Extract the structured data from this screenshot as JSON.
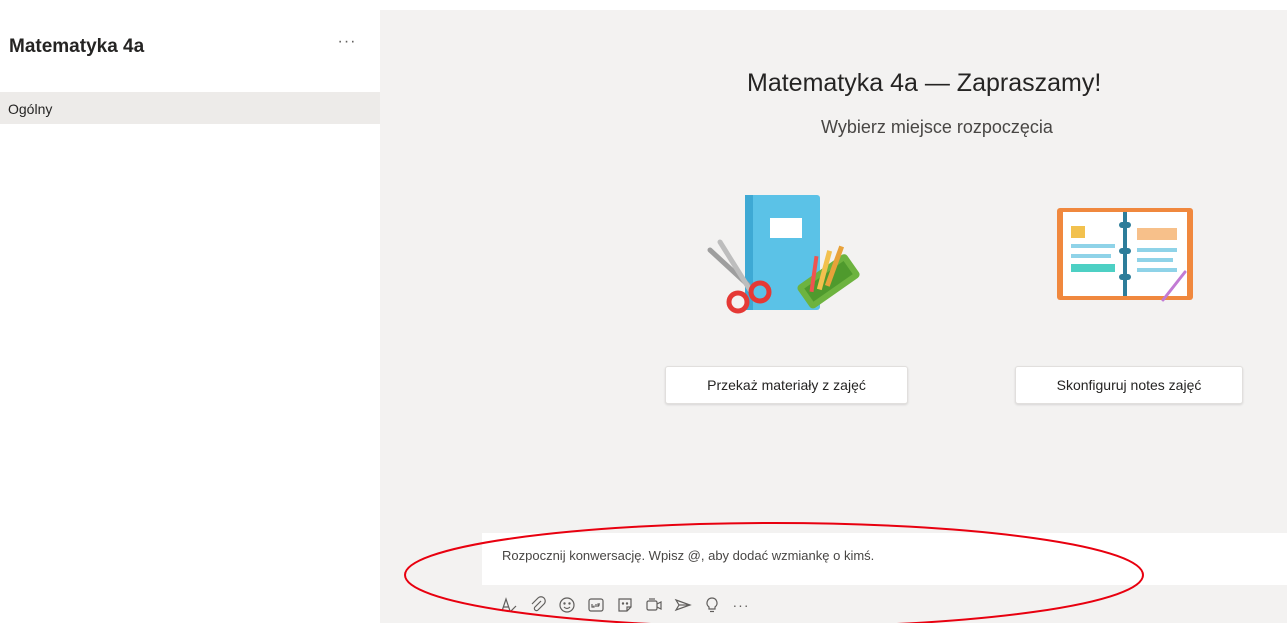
{
  "sidebar": {
    "team_name": "Matematyka 4a",
    "more_label": "···",
    "channels": [
      {
        "label": "Ogólny"
      }
    ]
  },
  "main": {
    "title": "Matematyka 4a — Zapraszamy!",
    "subtitle": "Wybierz miejsce rozpoczęcia",
    "actions": {
      "materials_label": "Przekaż materiały z zajęć",
      "notes_label": "Skonfiguruj notes zajęć"
    }
  },
  "compose": {
    "placeholder": "Rozpocznij konwersację. Wpisz @, aby dodać wzmiankę o kimś.",
    "toolbar_icons": [
      "format-icon",
      "attach-icon",
      "emoji-icon",
      "gif-icon",
      "sticker-icon",
      "meet-icon",
      "praise-icon",
      "bulb-icon",
      "more-icon"
    ],
    "more_label": "···"
  },
  "colors": {
    "main_background": "#f3f2f1",
    "selected_channel": "#edebe9",
    "annotation": "#e8000f"
  }
}
